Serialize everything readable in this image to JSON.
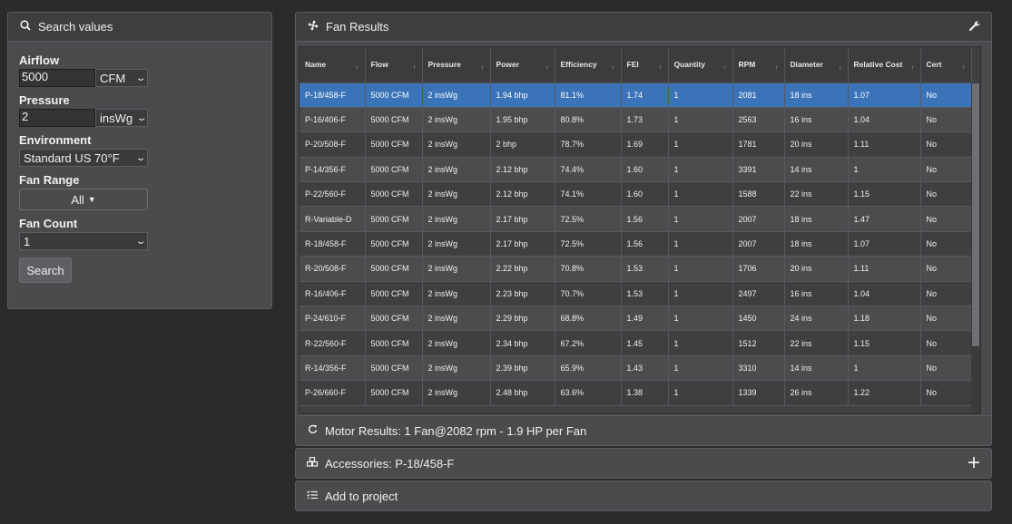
{
  "search": {
    "title": "Search values",
    "airflow_label": "Airflow",
    "airflow_value": "5000",
    "airflow_unit": "CFM",
    "pressure_label": "Pressure",
    "pressure_value": "2",
    "pressure_unit": "insWg",
    "environment_label": "Environment",
    "environment_value": "Standard US 70°F",
    "fan_range_label": "Fan Range",
    "fan_range_value": "All",
    "fan_count_label": "Fan Count",
    "fan_count_value": "1",
    "search_button": "Search"
  },
  "results": {
    "title": "Fan Results",
    "columns": [
      "Name",
      "Flow",
      "Pressure",
      "Power",
      "Efficiency",
      "FEI",
      "Quantity",
      "RPM",
      "Diameter",
      "Relative Cost",
      "Cert"
    ],
    "rows": [
      [
        "P-18/458-F",
        "5000 CFM",
        "2 insWg",
        "1.94 bhp",
        "81.1%",
        "1.74",
        "1",
        "2081",
        "18 ins",
        "1.07",
        "No"
      ],
      [
        "P-16/406-F",
        "5000 CFM",
        "2 insWg",
        "1.95 bhp",
        "80.8%",
        "1.73",
        "1",
        "2563",
        "16 ins",
        "1.04",
        "No"
      ],
      [
        "P-20/508-F",
        "5000 CFM",
        "2 insWg",
        "2 bhp",
        "78.7%",
        "1.69",
        "1",
        "1781",
        "20 ins",
        "1.11",
        "No"
      ],
      [
        "P-14/356-F",
        "5000 CFM",
        "2 insWg",
        "2.12 bhp",
        "74.4%",
        "1.60",
        "1",
        "3391",
        "14 ins",
        "1",
        "No"
      ],
      [
        "P-22/560-F",
        "5000 CFM",
        "2 insWg",
        "2.12 bhp",
        "74.1%",
        "1.60",
        "1",
        "1588",
        "22 ins",
        "1.15",
        "No"
      ],
      [
        "R-Variable-D",
        "5000 CFM",
        "2 insWg",
        "2.17 bhp",
        "72.5%",
        "1.56",
        "1",
        "2007",
        "18 ins",
        "1.47",
        "No"
      ],
      [
        "R-18/458-F",
        "5000 CFM",
        "2 insWg",
        "2.17 bhp",
        "72.5%",
        "1.56",
        "1",
        "2007",
        "18 ins",
        "1.07",
        "No"
      ],
      [
        "R-20/508-F",
        "5000 CFM",
        "2 insWg",
        "2.22 bhp",
        "70.8%",
        "1.53",
        "1",
        "1706",
        "20 ins",
        "1.11",
        "No"
      ],
      [
        "R-16/406-F",
        "5000 CFM",
        "2 insWg",
        "2.23 bhp",
        "70.7%",
        "1.53",
        "1",
        "2497",
        "16 ins",
        "1.04",
        "No"
      ],
      [
        "P-24/610-F",
        "5000 CFM",
        "2 insWg",
        "2.29 bhp",
        "68.8%",
        "1.49",
        "1",
        "1450",
        "24 ins",
        "1.18",
        "No"
      ],
      [
        "R-22/560-F",
        "5000 CFM",
        "2 insWg",
        "2.34 bhp",
        "67.2%",
        "1.45",
        "1",
        "1512",
        "22 ins",
        "1.15",
        "No"
      ],
      [
        "R-14/356-F",
        "5000 CFM",
        "2 insWg",
        "2.39 bhp",
        "65.9%",
        "1.43",
        "1",
        "3310",
        "14 ins",
        "1",
        "No"
      ],
      [
        "P-26/660-F",
        "5000 CFM",
        "2 insWg",
        "2.48 bhp",
        "63.6%",
        "1.38",
        "1",
        "1339",
        "26 ins",
        "1.22",
        "No"
      ]
    ]
  },
  "motor_results": "Motor Results: 1 Fan@2082 rpm - 1.9 HP per Fan",
  "accessories": "Accessories: P-18/458-F",
  "add_to_project": "Add to project"
}
